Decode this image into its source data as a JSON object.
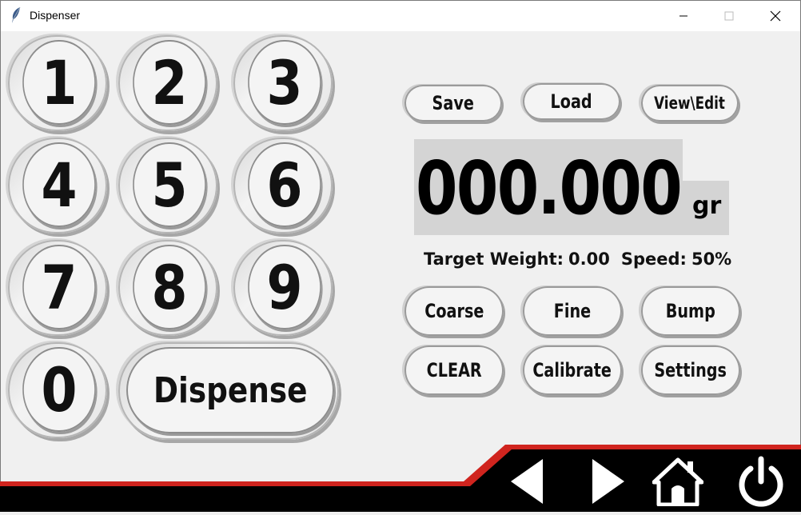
{
  "window": {
    "title": "Dispenser"
  },
  "keypad": {
    "keys": [
      "1",
      "2",
      "3",
      "4",
      "5",
      "6",
      "7",
      "8",
      "9",
      "0"
    ],
    "dispense_label": "Dispense"
  },
  "file_buttons": {
    "save": "Save",
    "load": "Load",
    "view_edit": "View\\Edit"
  },
  "display": {
    "weight": "000.000",
    "unit": "gr"
  },
  "status": {
    "target_label": "Target Weight:",
    "target_value": "0.00",
    "speed_label": "Speed:",
    "speed_value": "50%"
  },
  "mode_buttons": {
    "coarse": "Coarse",
    "fine": "Fine",
    "bump": "Bump"
  },
  "action_buttons": {
    "clear": "CLEAR",
    "calibrate": "Calibrate",
    "settings": "Settings"
  },
  "footer": {
    "icons": [
      "back-arrow-icon",
      "forward-arrow-icon",
      "home-icon",
      "power-icon"
    ],
    "colors": {
      "bar": "#000000",
      "accent": "#d0241e"
    }
  }
}
